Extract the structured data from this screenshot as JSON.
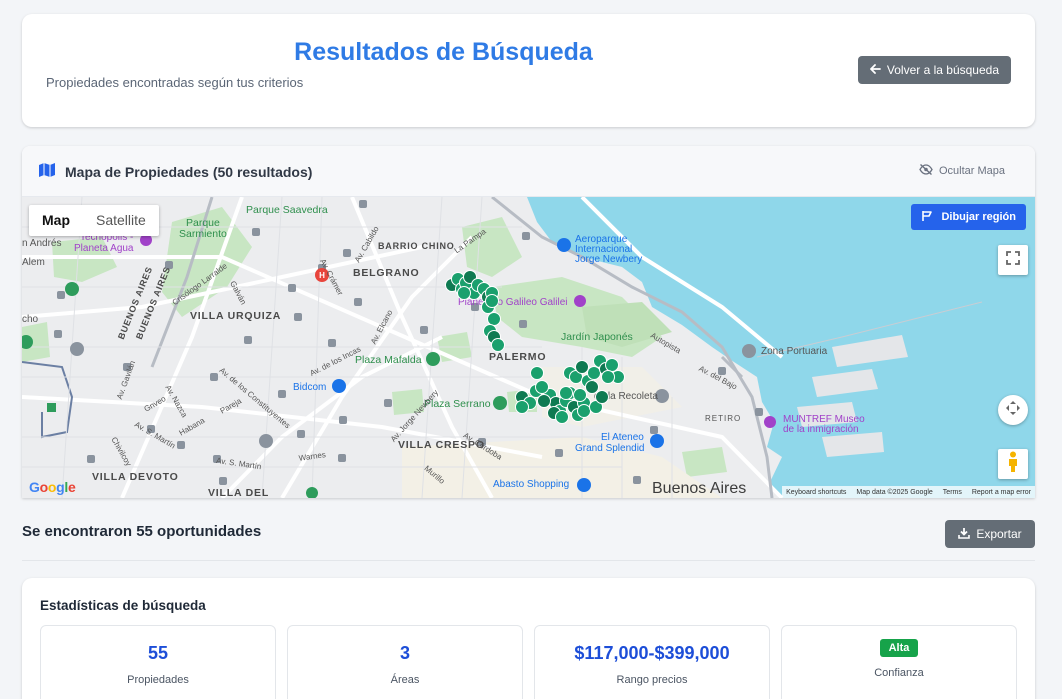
{
  "header": {
    "title": "Resultados de Búsqueda",
    "subtitle": "Propiedades encontradas según tus criterios",
    "back_button": "Volver a la búsqueda"
  },
  "map": {
    "title": "Mapa de Propiedades (50 resultados)",
    "hide_button": "Ocultar Mapa",
    "toggle": {
      "map": "Map",
      "satellite": "Satellite",
      "selected": "Map"
    },
    "draw_button": "Dibujar región",
    "google": "Google",
    "attribution": [
      "Keyboard shortcuts",
      "Map data ©2025 Google",
      "Terms",
      "Report a map error"
    ],
    "marker_count": 50,
    "labels": {
      "parque_saavedra": "Parque Saavedra",
      "parque": "Parque",
      "sarmiento": "Sarmiento",
      "tecnopolis": "Tecnópolis -",
      "planeta_agua": "Planeta Agua",
      "san_andres": "n Andrés",
      "alem": "Alem",
      "barrio_chino": "BARRIO CHINO",
      "belgrano": "BELGRANO",
      "villa_urquiza": "VILLA URQUIZA",
      "palermo": "PALERMO",
      "villa_crespo": "VILLA CRESPO",
      "villa_devoto": "VILLA DEVOTO",
      "villa_del": "VILLA DEL",
      "retiro": "RETIRO",
      "aeroparque_1": "Aeroparque",
      "aeroparque_2": "Internacional",
      "aeroparque_3": "Jorge Newbery",
      "planetario": "Planetario Galileo Galilei",
      "jardin_japones": "Jardín Japonés",
      "plaza_mafalda": "Plaza Mafalda",
      "plaza_serrano": "Plaza Serrano",
      "bidcom": "Bidcom",
      "recoleta": "de la Recoleta",
      "zona_portuaria": "Zona Portuaria",
      "muntref_1": "MUNTREF Museo",
      "muntref_2": "de la inmigración",
      "el_ateneo_1": "El Ateneo",
      "el_ateneo_2": "Grand Splendid",
      "abasto": "Abasto Shopping",
      "buenos_aires": "Buenos Aires",
      "av_gral_paz": "BUENOS AIRES",
      "av_gral_paz_2": "BUENOS AIRES",
      "cho": "cho",
      "av_cabildo": "Av. Cabildo",
      "av_cramer": "Av. Crámer",
      "av_la_pampa": "La Pampa",
      "galvan": "Galván",
      "crisologo": "Crisólogo Larralde",
      "av_de_los_incas": "Av. de los Incas",
      "av_elcano": "Av. Elcano",
      "av_nazca": "Av. Nazca",
      "av_de_los_constituyentes": "Av. de los Constituyentes",
      "gavilan": "Av. Gavilán",
      "habana": "Habana",
      "pareja": "Pareja",
      "av_s_martin": "Av. S. Martín",
      "av_s_martin_2": "Av. S. Martín",
      "warnes": "Warnes",
      "av_jorge_newbery": "Av. Jorge Newbery",
      "av_cordoba": "Av. Córdoba",
      "murillo": "Murillo",
      "av_del_bajo": "Av. del Bajo",
      "autopista": "Autopista",
      "av_cramer_2": "Av. Crámer",
      "gnveo": "Gnveo",
      "chivilcoy": "Chivilcoy"
    }
  },
  "results": {
    "title": "Se encontraron 55 oportunidades",
    "export_button": "Exportar"
  },
  "stats": {
    "title": "Estadísticas de búsqueda",
    "items": [
      {
        "value": "55",
        "label": "Propiedades"
      },
      {
        "value": "3",
        "label": "Áreas"
      },
      {
        "value": "$117,000-$399,000",
        "label": "Rango precios"
      },
      {
        "badge": "Alta",
        "label": "Confianza"
      }
    ]
  },
  "colors": {
    "accent": "#2f7be5",
    "marker": "#1aa06d",
    "marker_dark": "#0f7a52",
    "water": "#8fd7ea",
    "park": "#c8e6c3",
    "draw_button": "#2563eb",
    "badge": "#16a34a"
  }
}
